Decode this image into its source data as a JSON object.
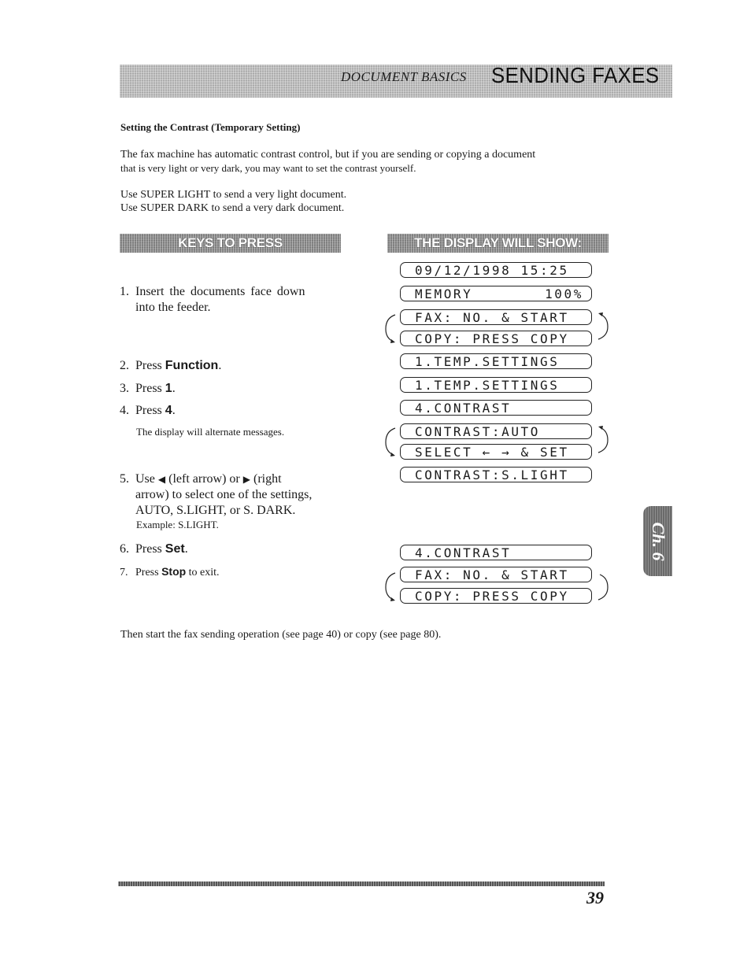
{
  "header": {
    "section": "DOCUMENT BASICS",
    "title": "SENDING FAXES"
  },
  "section_heading": "Setting the Contrast (Temporary Setting)",
  "intro": {
    "line1": "The fax machine has automatic contrast control, but if you are sending or copying  a document",
    "line2": "that is very light or very dark, you may want to set the contrast yourself."
  },
  "use_lines": [
    "Use SUPER LIGHT to send a very light document.",
    "Use SUPER DARK to send a very dark document."
  ],
  "columns": {
    "keys_heading": "KEYS TO PRESS",
    "display_heading": "THE DISPLAY WILL SHOW:"
  },
  "steps": [
    {
      "num": "1.",
      "line1": "Insert the documents face down",
      "line2": "into the feeder."
    },
    {
      "num": "2.",
      "pre": "Press ",
      "key": "Function",
      "post": "."
    },
    {
      "num": "3.",
      "pre": "Press ",
      "key": "1",
      "post": "."
    },
    {
      "num": "4.",
      "pre": "Press ",
      "key": "4",
      "post": "."
    },
    {
      "num": "5.",
      "line1a": "Use ",
      "left_arrow": "◀",
      "line1b": " (left arrow) or ",
      "right_arrow": "▶",
      "line1c": " (right",
      "line2": "arrow) to select one of the settings,",
      "line3": "AUTO, S.LIGHT, or S. DARK."
    },
    {
      "num": "6.",
      "pre": "Press ",
      "key": "Set",
      "post": "."
    },
    {
      "num": "7.",
      "pre": "Press ",
      "key": "Stop",
      "post": " to exit."
    }
  ],
  "notes": {
    "alternate": "The display will alternate messages.",
    "example": "Example: S.LIGHT."
  },
  "lcd": {
    "datetime": "09/12/1998 15:25",
    "memory_label": "MEMORY",
    "memory_value": "100%",
    "fax_start": "FAX: NO. & START",
    "copy_press": "COPY: PRESS COPY",
    "temp_settings_1": "1.TEMP.SETTINGS",
    "temp_settings_2": "1.TEMP.SETTINGS",
    "contrast_menu": "4.CONTRAST",
    "contrast_auto": "CONTRAST:AUTO",
    "select_set": "SELECT ← → & SET",
    "contrast_slight": "CONTRAST:S.LIGHT",
    "contrast_menu_2": "4.CONTRAST",
    "fax_start_2": "FAX: NO. & START",
    "copy_press_2": "COPY: PRESS COPY"
  },
  "footer_text": "Then start the fax sending operation (see page 40) or copy (see page 80).",
  "chapter_tab": "Ch. 6",
  "page_number": "39"
}
